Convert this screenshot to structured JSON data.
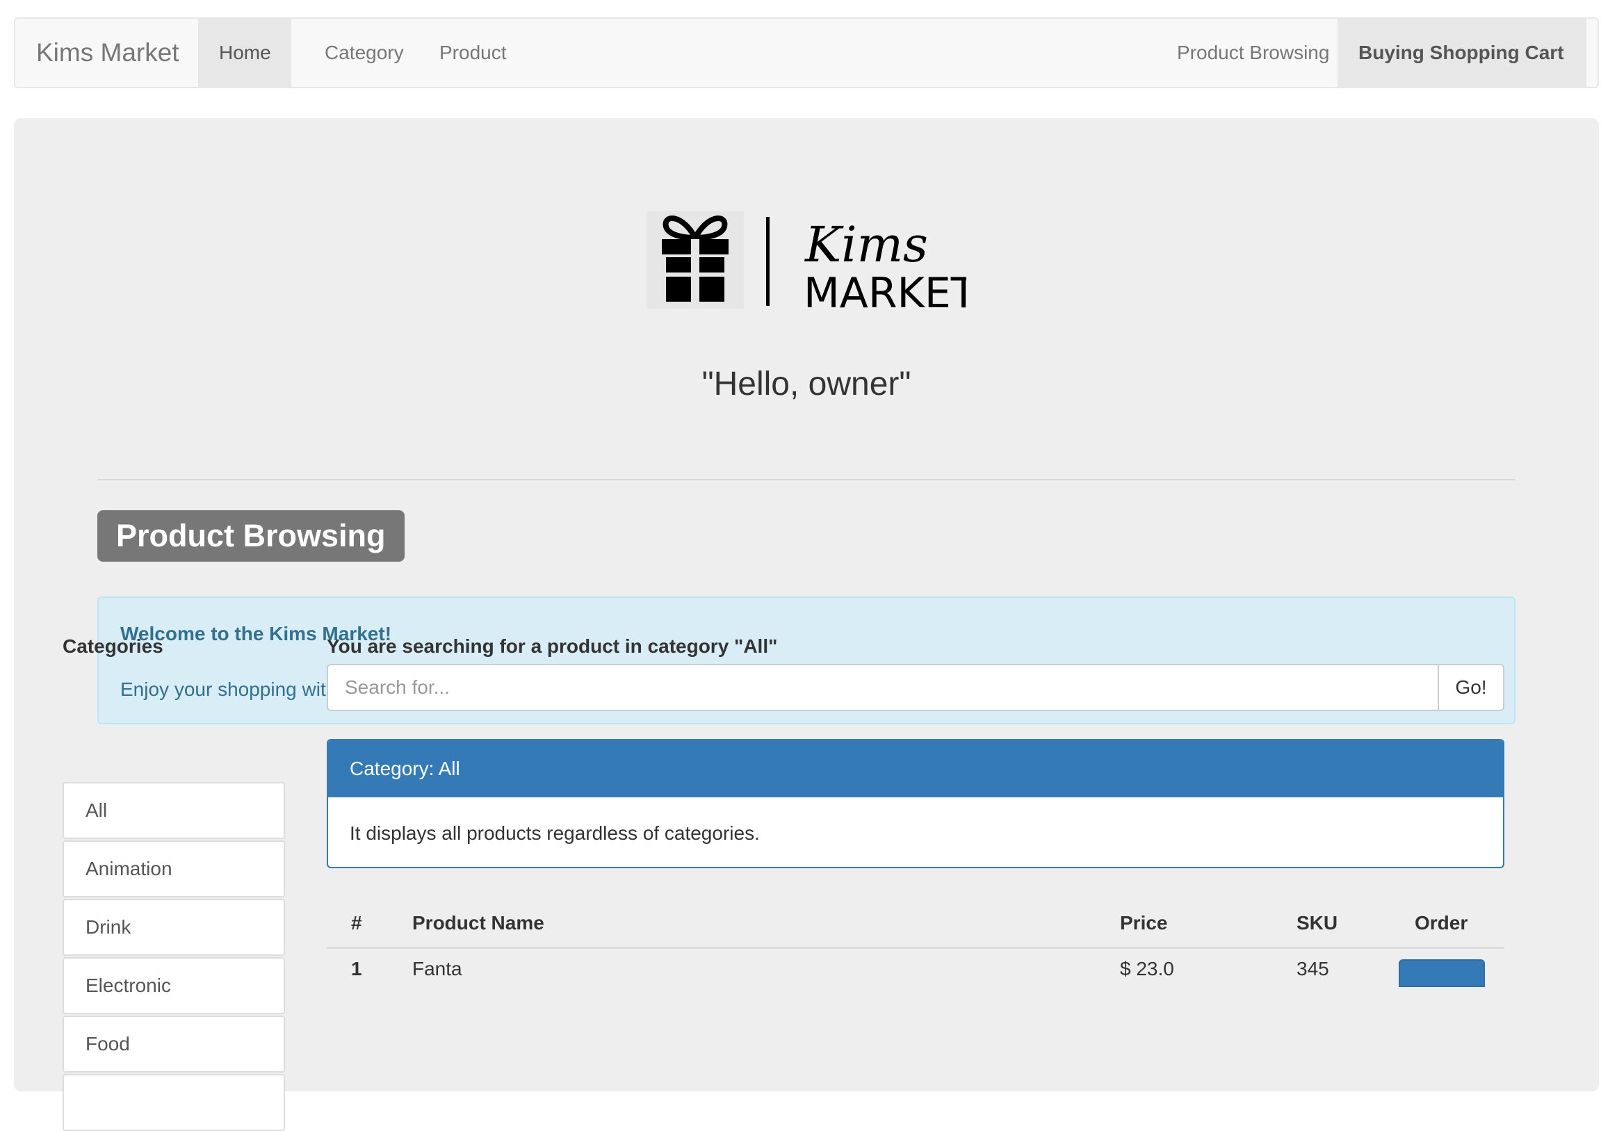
{
  "navbar": {
    "brand": "Kims Market",
    "left_items": [
      {
        "label": "Home"
      },
      {
        "label": "Category"
      },
      {
        "label": "Product"
      }
    ],
    "right_items": [
      {
        "label": "Product Browsing"
      },
      {
        "label": "Buying Shopping Cart"
      }
    ]
  },
  "hero": {
    "logo": {
      "script": "Kims",
      "word": "MARKET"
    },
    "greeting": "\"Hello, owner\""
  },
  "section_label": "Product Browsing",
  "alert": {
    "title": "Welcome to the Kims Market!",
    "text": "Enjoy your shopping with many types of products!"
  },
  "categories": {
    "heading": "Categories",
    "items": [
      "All",
      "Animation",
      "Drink",
      "Electronic",
      "Food",
      ""
    ]
  },
  "search": {
    "heading": "You are searching for a product in category \"All\"",
    "placeholder": "Search for...",
    "button": "Go!"
  },
  "panel": {
    "title": "Category: All",
    "body": "It displays all products regardless of categories."
  },
  "table": {
    "headers": [
      "#",
      "Product Name",
      "Price",
      "SKU",
      "Order"
    ],
    "rows": [
      {
        "num": "1",
        "name": "Fanta",
        "price": "$ 23.0",
        "sku": "345"
      }
    ]
  },
  "colors": {
    "primary": "#337ab7",
    "info_bg": "#d9edf7",
    "info_text": "#31708f",
    "label_bg": "#777777",
    "jumbotron_bg": "#eeeeee"
  }
}
